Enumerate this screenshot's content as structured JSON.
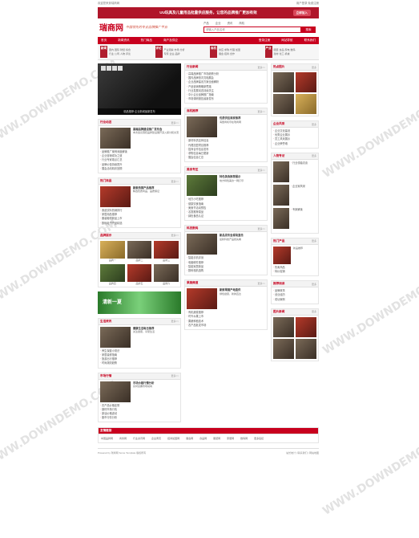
{
  "topbar": {
    "left": "欢迎您来到瑞商网",
    "right": "用户登录  免费注册"
  },
  "banner": {
    "text": "UU玩具及儿童用品批量供应服务，让您的品牌推广更加有效",
    "button": "立即加入"
  },
  "header": {
    "logo": "瑞商网",
    "slogan": "中国领先的专业品牌推广平台"
  },
  "search": {
    "tabs": [
      "产品",
      "企业",
      "资讯",
      "商机"
    ],
    "placeholder": "请输入产品名称",
    "button": "搜索"
  },
  "nav": {
    "items": [
      "首页",
      "新闻资讯",
      "热门商品",
      "商户及供应"
    ],
    "right": [
      "登录注册",
      "网站导航",
      "联系我们"
    ]
  },
  "cats": [
    {
      "key": "新闻",
      "lines": [
        "国内·国际·财经·综合",
        "行业·公司·人物·评论"
      ]
    },
    {
      "key": "评论",
      "lines": [
        "产业观察·市场·分析",
        "专家·企业·品牌"
      ]
    },
    {
      "key": "商机",
      "lines": [
        "供应·求购·代理·加盟",
        "展会·招商·合作"
      ]
    },
    {
      "key": "产业",
      "lines": [
        "服装·食品·家电·数码",
        "建材·化工·机械"
      ]
    }
  ],
  "slide": {
    "caption": "精品推荐·企业新闻最新发布"
  },
  "news_box": {
    "title": "行业新闻",
    "more": "更多>>",
    "items": [
      "高端品牌推广市场趋势分析",
      "国内品牌首次亮相展会",
      "企业品牌建设方案全面解析",
      "产品营销策略新思路",
      "行业发展动态持续关注",
      "中小企业品牌推广指南",
      "市场调研报告最新发布"
    ]
  },
  "cases_box": {
    "title": "行业动态",
    "more": "更多>>",
    "lead_title": "高端品牌建设推广发布会",
    "lead_text": "本次会议围绕品牌建设展开深入探讨和交流",
    "items": [
      "品牌推广案例深度解读",
      "企业营销成功之道",
      "行业专家观点汇总",
      "品牌价值持续提升",
      "展会活动精彩回顾",
      "产品质量管理新标准"
    ]
  },
  "hot_box": {
    "title": "热门商品",
    "more": "更多>>",
    "lead_title": "新款热销产品推荐",
    "lead_text": "精选优质商品，品质保证",
    "items": [
      "食品饮料热销排行",
      "家居用品推荐",
      "服装鞋帽新品上市",
      "数码电子产品精选",
      "母婴用品口碑推荐"
    ]
  },
  "biz_box": {
    "title": "商机推荐",
    "more": "更多>>",
    "lead_title": "优质供应商家推荐",
    "lead_text": "海量商机尽在瑞商网",
    "items": [
      "原材料供应商信息",
      "代理加盟项目推荐",
      "招商合作信息发布",
      "求购信息每日更新",
      "展会信息汇总"
    ]
  },
  "product_box": {
    "title": "品牌展示",
    "more": "更多>>",
    "captions": [
      "品牌一",
      "品牌二",
      "品牌三",
      "品牌四",
      "品牌五",
      "品牌六"
    ]
  },
  "food_box": {
    "title": "美食专区",
    "more": "更多>>",
    "lead_title": "特色美食推荐展示",
    "lead_text": "地方特色美食一网打尽",
    "items": [
      "地方小吃推荐",
      "健康饮食指南",
      "美食节活动预告",
      "名厨推荐菜品",
      "绿色食品认证"
    ]
  },
  "ad": {
    "text": "清新一夏"
  },
  "life_box": {
    "title": "生活资讯",
    "more": "更多>>",
    "lead_title": "健康生活每日推荐",
    "lead_text": "关注健康，享受生活",
    "items": [
      "养生保健小常识",
      "家居装修指南",
      "旅游出行推荐",
      "时尚潮流趋势",
      "亲子教育分享"
    ]
  },
  "tech_box": {
    "title": "科技数码",
    "more": "更多>>",
    "lead_title": "新品发布会现场直击",
    "lead_text": "最新科技产品抢先看",
    "items": [
      "智能手机评测",
      "电脑硬件推荐",
      "智能家居新品",
      "数码相机选购",
      "科技前沿资讯"
    ]
  },
  "market_box": {
    "title": "市场行情",
    "more": "更多>>",
    "lead_title": "市场价格行情分析",
    "lead_text": "实时掌握市场动向",
    "items": [
      "农产品价格走势",
      "钢材市场行情",
      "原油价格波动",
      "股市行情分析",
      "汇率变化报告"
    ]
  },
  "fruit_box": {
    "title": "果蔬频道",
    "more": "更多>>",
    "lead_title": "新鲜果蔬产地直供",
    "lead_text": "绿色健康，新鲜直达",
    "items": [
      "有机蔬菜推荐",
      "时令水果上市",
      "果蔬种植技术",
      "农产品批发市场",
      "果蔬保鲜方法"
    ]
  },
  "side1": {
    "title": "热点图片",
    "more": "更多"
  },
  "side2": {
    "title": "企业风采",
    "more": "更多",
    "items": [
      "企业文化建设",
      "优秀企业展示",
      "员工风采展示",
      "企业荣誉墙"
    ]
  },
  "side3": {
    "title": "人物专访",
    "more": "更多",
    "people": [
      "行业领袖访谈",
      "企业家风采",
      "专家解读"
    ]
  },
  "side4": {
    "title": "热门产品",
    "more": "更多",
    "items": [
      "新品推荐",
      "热卖商品",
      "特价促销"
    ]
  },
  "side5": {
    "title": "推荐阅读",
    "more": "更多",
    "items": [
      "品牌故事",
      "创业经历",
      "成功案例"
    ]
  },
  "side6": {
    "title": "图片新闻",
    "more": "更多"
  },
  "friend": {
    "title": "友情链接",
    "links": [
      "中国品牌网",
      "商务网",
      "行业资讯网",
      "企业黄页",
      "招商加盟网",
      "展会网",
      "食品网",
      "服装网",
      "家居网",
      "数码网",
      "更多链接"
    ]
  },
  "footer": {
    "left": "Powered by 瑞商网 Some Template 版权所有",
    "right": "站长统计 | 联系我们 | 网站地图"
  },
  "watermark": "WWW.DOWNDEMO.COM"
}
